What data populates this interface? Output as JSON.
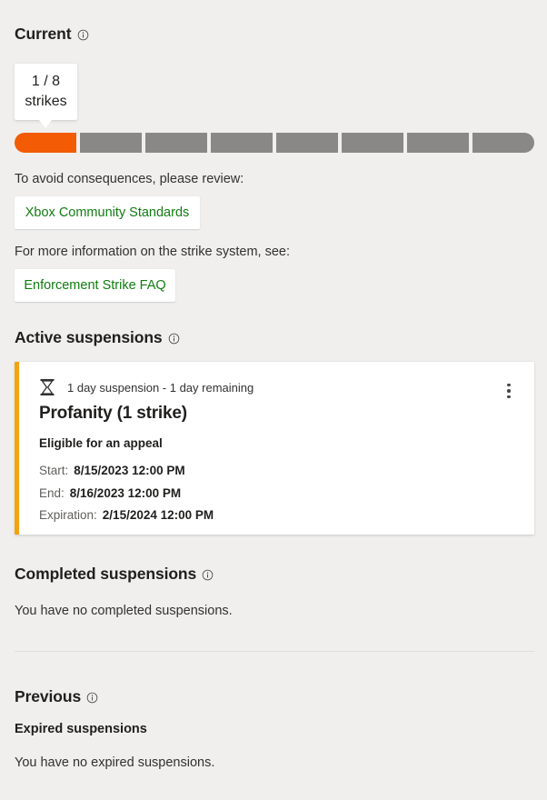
{
  "current": {
    "heading": "Current",
    "info_icon": "info-circle-icon",
    "callout": {
      "line1": "1 / 8",
      "line2": "strikes"
    },
    "strikes": {
      "total": 8,
      "used": 1,
      "filled_color": "#F35B04",
      "empty_color": "#8A8886"
    },
    "prompt_review": "To avoid consequences, please review:",
    "link_standards": "Xbox Community Standards",
    "prompt_more_info": "For more information on the strike system, see:",
    "link_faq": "Enforcement Strike FAQ",
    "link_color": "#107C10"
  },
  "active_suspensions": {
    "heading": "Active suspensions",
    "info_icon": "info-circle-icon",
    "card": {
      "accent_color": "#F2A30F",
      "status_icon": "hourglass-icon",
      "duration": "1 day suspension - 1 day remaining",
      "title": "Profanity (1 strike)",
      "appeal": "Eligible for an appeal",
      "dates": [
        {
          "label": "Start:",
          "value": "8/15/2023 12:00 PM"
        },
        {
          "label": "End:",
          "value": "8/16/2023 12:00 PM"
        },
        {
          "label": "Expiration:",
          "value": "2/15/2024 12:00 PM"
        }
      ],
      "menu_icon": "more-options-icon"
    }
  },
  "completed_suspensions": {
    "heading": "Completed suspensions",
    "info_icon": "info-circle-icon",
    "empty_message": "You have no completed suspensions."
  },
  "previous": {
    "heading": "Previous",
    "info_icon": "info-circle-icon",
    "expired_heading": "Expired suspensions",
    "expired_empty_message": "You have no expired suspensions."
  }
}
